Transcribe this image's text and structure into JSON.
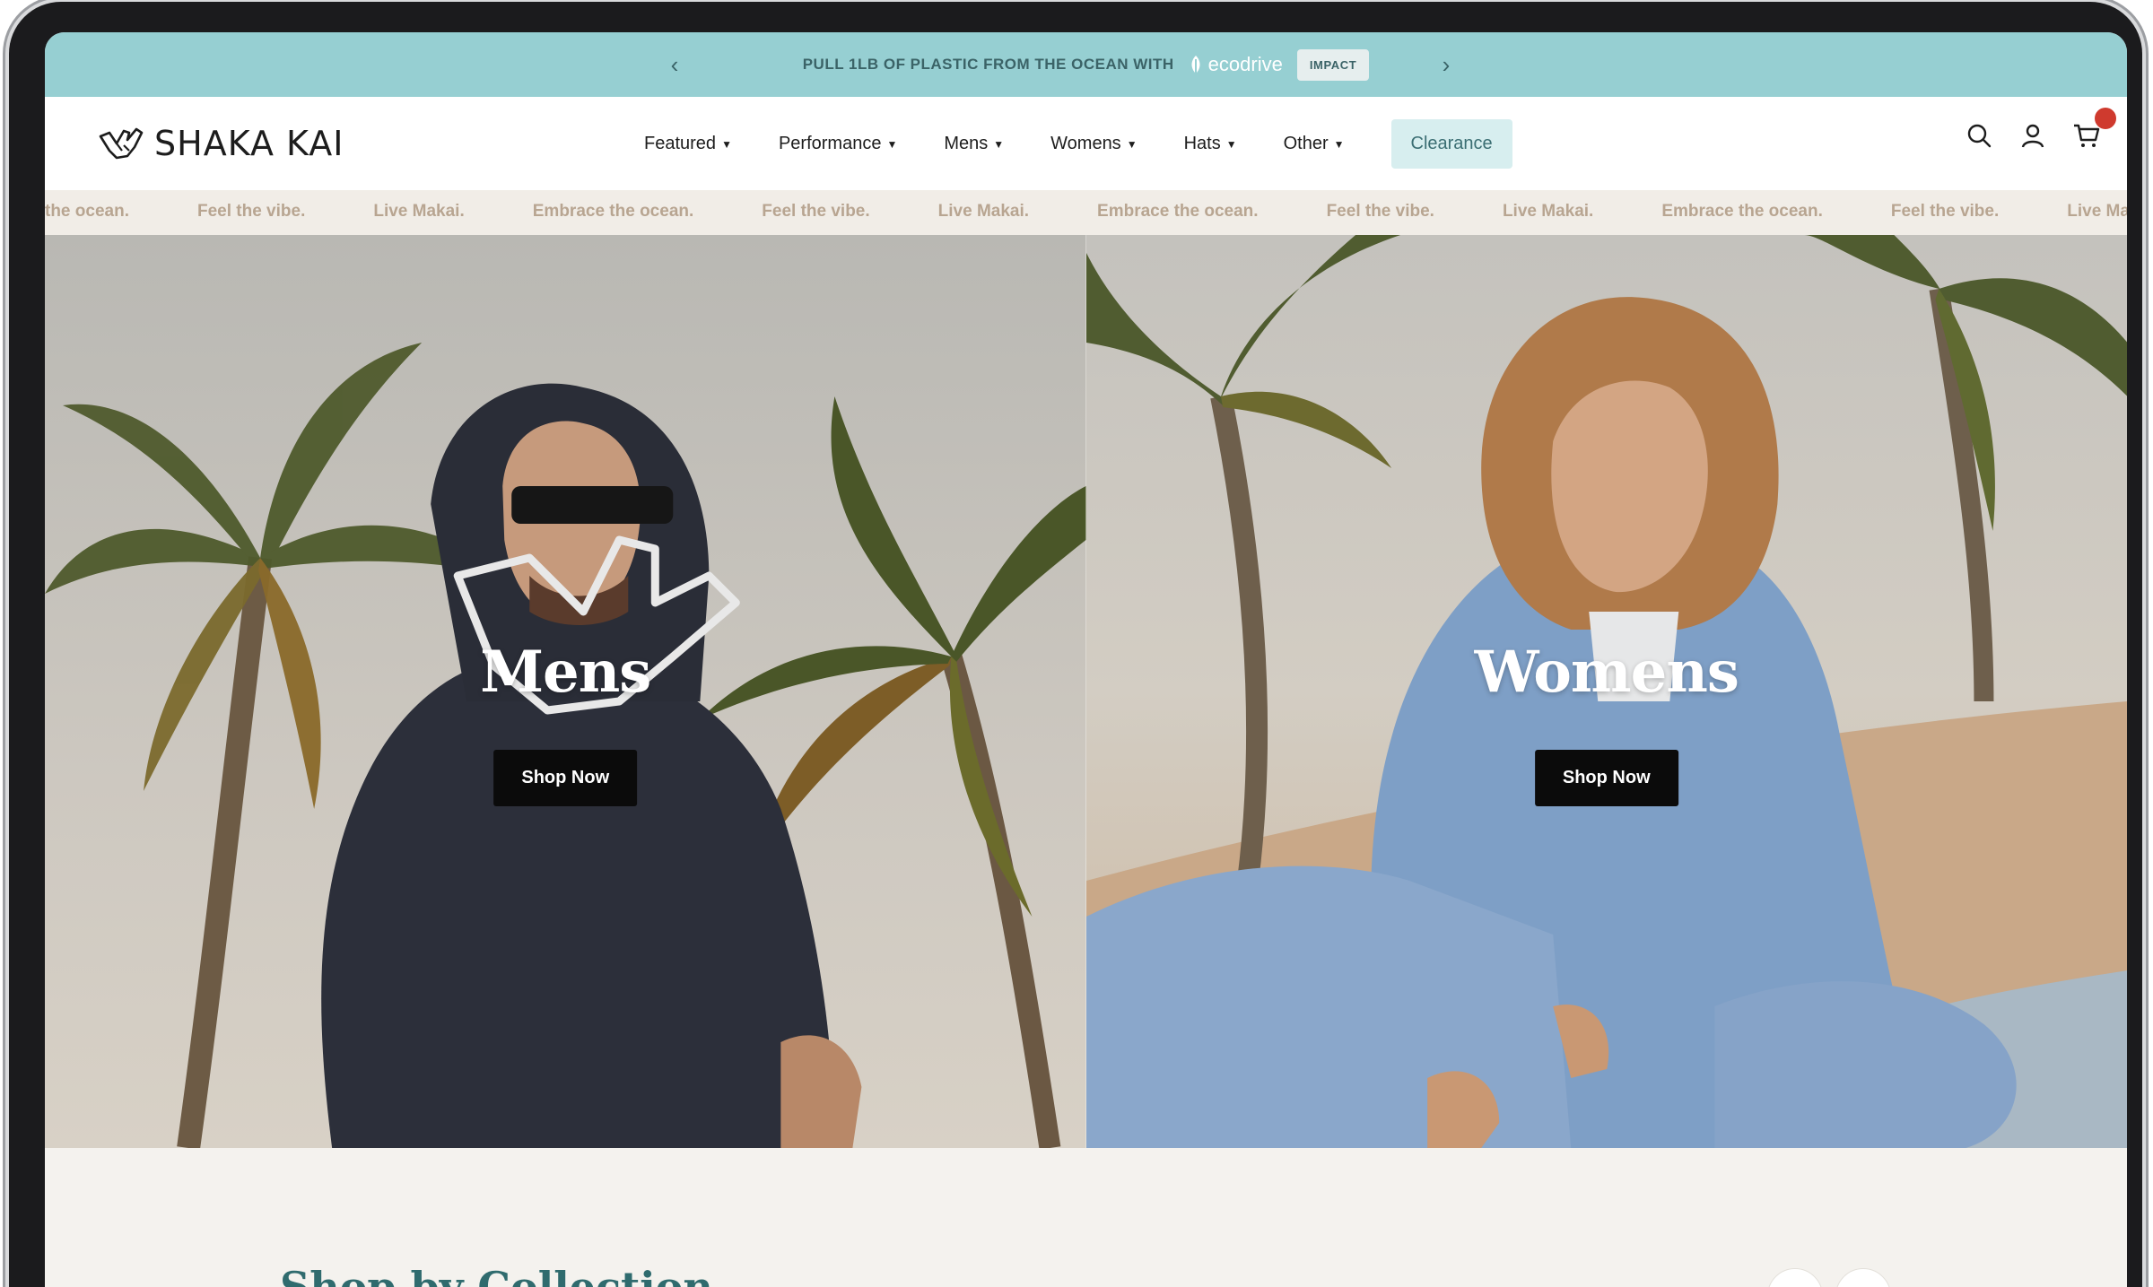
{
  "announcement": {
    "text": "PULL 1LB OF PLASTIC FROM THE OCEAN WITH",
    "partner": "ecodrive",
    "button": "IMPACT",
    "prev_icon": "chevron-left-icon",
    "next_icon": "chevron-right-icon"
  },
  "header": {
    "logo_text": "SHAKA KAI",
    "nav": [
      {
        "label": "Featured"
      },
      {
        "label": "Performance"
      },
      {
        "label": "Mens"
      },
      {
        "label": "Womens"
      },
      {
        "label": "Hats"
      },
      {
        "label": "Other"
      }
    ],
    "clearance": "Clearance",
    "icons": [
      "search-icon",
      "account-icon",
      "cart-icon"
    ]
  },
  "marquee": [
    "the ocean.",
    "Feel the vibe.",
    "Live Makai.",
    "Embrace the ocean.",
    "Feel the vibe.",
    "Live Makai.",
    "Embrace the ocean.",
    "Feel the vibe.",
    "Live Makai.",
    "Embrace the ocean.",
    "Feel the vibe.",
    "Live Maka"
  ],
  "hero": {
    "mens": {
      "title": "Mens",
      "button": "Shop Now"
    },
    "womens": {
      "title": "Womens",
      "button": "Shop Now"
    }
  },
  "section": {
    "title": "Shop by Collection"
  },
  "colors": {
    "announcement_bg": "#96cfd2",
    "clearance_bg": "#d7eeef",
    "accent_teal": "#2f6b6e",
    "cart_badge": "#cf3a2e",
    "marquee_text": "#b8a591"
  }
}
